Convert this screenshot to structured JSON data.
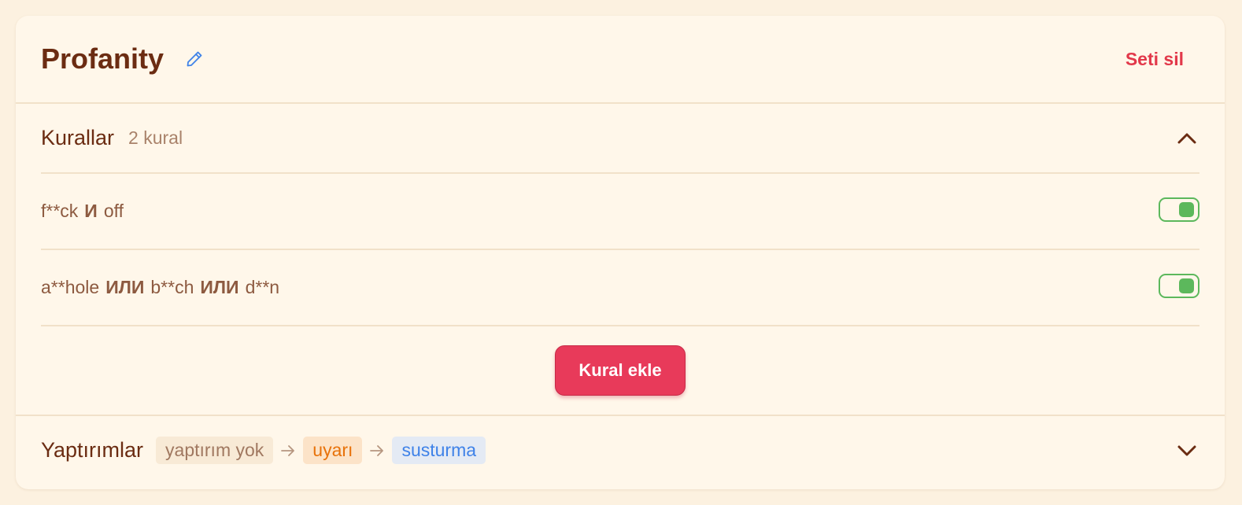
{
  "set": {
    "title": "Profanity",
    "delete_label": "Seti sil"
  },
  "rules": {
    "title": "Kurallar",
    "count": "2 kural",
    "items": [
      {
        "parts": [
          {
            "t": "f**ck",
            "op": false
          },
          {
            "t": "И",
            "op": true
          },
          {
            "t": "off",
            "op": false
          }
        ],
        "enabled": true
      },
      {
        "parts": [
          {
            "t": "a**hole",
            "op": false
          },
          {
            "t": "ИЛИ",
            "op": true
          },
          {
            "t": "b**ch",
            "op": false
          },
          {
            "t": "ИЛИ",
            "op": true
          },
          {
            "t": "d**n",
            "op": false
          }
        ],
        "enabled": true
      }
    ],
    "add_label": "Kural ekle"
  },
  "sanctions": {
    "title": "Yaptırımlar",
    "steps": [
      "yaptırım yok",
      "uyarı",
      "susturma"
    ]
  },
  "colors": {
    "accent": "#e83a5a",
    "toggle_on": "#5cb85c",
    "title": "#6b2c12"
  },
  "icons": {
    "edit": "pencil-icon",
    "collapse": "chevron-up-icon",
    "expand": "chevron-down-icon",
    "step": "arrow-right-icon"
  }
}
